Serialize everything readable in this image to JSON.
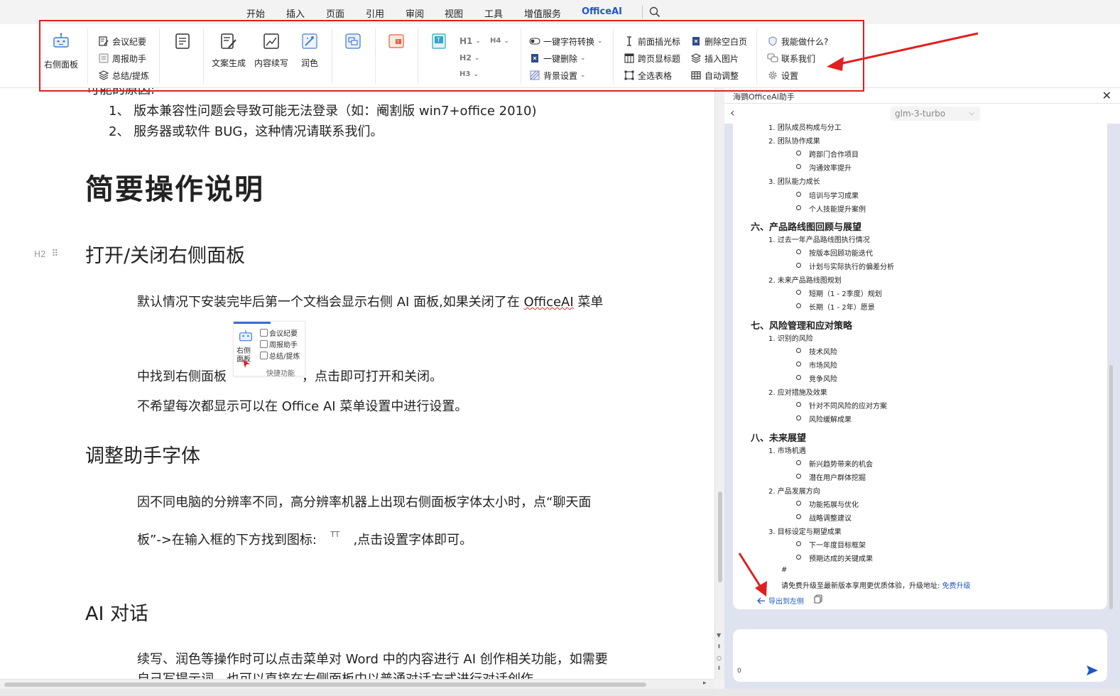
{
  "menu": {
    "tabs": [
      "开始",
      "插入",
      "页面",
      "引用",
      "审阅",
      "视图",
      "工具",
      "增值服务",
      "OfficeAI"
    ],
    "active_tab": "OfficeAI"
  },
  "ribbon": {
    "right_panel": "右侧面板",
    "meeting_minutes": "会议纪要",
    "weekly_report": "周报助手",
    "summary": "总结/提炼",
    "copy_gen": "文案生成",
    "continue_write": "内容续写",
    "polish": "润色",
    "h1": "H1",
    "h2": "H2",
    "h3": "H3",
    "h4": "H4",
    "char_convert": "一键字符转换",
    "one_click_delete": "一键删除",
    "bg_settings": "背景设置",
    "insert_cursor": "前面插光标",
    "cross_page_title": "跨页显标题",
    "select_all_tables": "全选表格",
    "delete_blank_page": "删除空白页",
    "insert_image": "插入图片",
    "auto_adjust": "自动调整",
    "what_can_i_do": "我能做什么?",
    "contact_us": "联系我们",
    "settings": "设置"
  },
  "document": {
    "para_partial_top": "可能的原因:",
    "reason1": "1、 版本兼容性问题会导致可能无法登录（如：阉割版 win7+office 2010)",
    "reason2": "2、 服务器或软件 BUG，这种情况请联系我们。",
    "h1_ops": "简要操作说明",
    "h2_panel": "打开/关闭右侧面板",
    "p_panel1_a": "默认情况下安装完毕后第一个文档会显示右侧 AI 面板,如果关闭了在 ",
    "p_panel1_b": "OfficeAI",
    "p_panel1_c": " 菜单",
    "p_panel2_a": "中找到右侧面板",
    "p_panel2_b": "，点击即可打开和关闭。",
    "p_panel3": "不希望每次都显示可以在 Office AI 菜单设置中进行设置。",
    "inline_image": {
      "meeting": "会议纪要",
      "weekly": "周报助手",
      "summary": "总结/提炼",
      "side": "右侧面板",
      "footer": "快捷功能"
    },
    "h2_font": "调整助手字体",
    "p_font1": "因不同电脑的分辨率不同，高分辨率机器上出现右侧面板字体太小时，点“聊天面",
    "p_font2_a": "板”->在输入框的下方找到图标:",
    "p_font2_icon": "TT",
    "p_font2_b": ",点击设置字体即可。",
    "h2_ai": "AI 对话",
    "p_ai1": "续写、润色等操作时可以点击菜单对 Word 中的内容进行 AI 创作相关功能，如需要",
    "p_ai2": "自己写提示词，也可以直接在右侧面板中以普通对话方式进行对话创作。",
    "h2_marker": "H2"
  },
  "panel": {
    "title": "海鹦OfficeAI助手",
    "model": "glm-3-turbo",
    "chat": {
      "top_partial": "1.   团队成员构成与分工",
      "item_team_collab": "2.   团队协作成果",
      "b_cross_dept": "跨部门合作项目",
      "b_comm_eff": "沟通效率提升",
      "item_team_cap": "3.   团队能力成长",
      "b_training": "培训与学习成果",
      "b_personal": "个人技能提升案例",
      "sec6": "六、产品路线图回顾与展望",
      "item_past_year": "1.   过去一年产品路线图执行情况",
      "b_by_version": "按版本回顾功能迭代",
      "b_deviation": "计划与实际执行的偏差分析",
      "item_future_road": "2.   未来产品路线图规划",
      "b_short": "短期（1 - 2季度）规划",
      "b_long": "长期（1 - 2年）愿景",
      "sec7": "七、风险管理和应对策略",
      "item_risks": "1.   识别的风险",
      "b_tech": "技术风险",
      "b_market": "市场风险",
      "b_compete": "竞争风险",
      "item_measures": "2.   应对措施及效果",
      "b_strategy": "针对不同风险的应对方案",
      "b_mitigation": "风险缓解成果",
      "sec8": "八、未来展望",
      "item_market_opp": "1.   市场机遇",
      "b_new_trend": "新兴趋势带来的机会",
      "b_potential": "潜在用户群体挖掘",
      "item_product_dir": "2.   产品发展方向",
      "b_expand": "功能拓展与优化",
      "b_adjust": "战略调整建议",
      "item_goals": "3.   目标设定与期望成果",
      "b_next_year": "下一年度目标框架",
      "b_key_results": "预期达成的关键成果",
      "hash": "#",
      "upgrade_text": "请免费升级至最新版本享用更优质体验，升级地址:",
      "upgrade_link": "免费升级",
      "export": "导出到左侧"
    },
    "input": {
      "counter": "0"
    }
  },
  "colors": {
    "accent": "#1f57c3",
    "highlight": "#e02020",
    "panel_bg": "#dfe3ef"
  }
}
